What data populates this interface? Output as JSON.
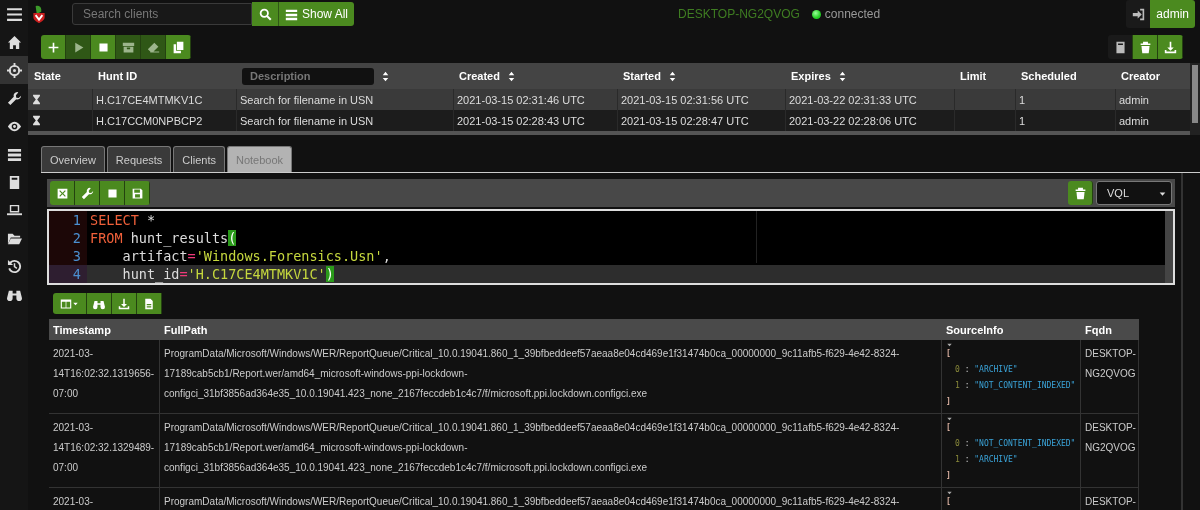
{
  "sidebar": {
    "items": [
      {
        "selected": false
      },
      {
        "selected": true
      },
      {
        "selected": false
      },
      {
        "selected": false
      },
      {
        "selected": false
      },
      {
        "selected": false
      },
      {
        "selected": false
      },
      {
        "selected": false
      },
      {
        "selected": false
      },
      {
        "selected": false
      }
    ]
  },
  "top_bar": {
    "search": {
      "placeholder": "Search clients"
    },
    "show_all": "Show All",
    "hostname": "DESKTOP-NG2QVOG",
    "connected": true,
    "status": "connected",
    "user": "admin"
  },
  "hunt_toolbar": {
    "buttons": [
      {
        "disabled": false
      },
      {
        "disabled": true
      },
      {
        "disabled": false
      },
      {
        "disabled": true
      },
      {
        "disabled": true
      },
      {
        "disabled": false
      }
    ],
    "right_buttons": [
      {
        "disabled": true
      },
      {
        "disabled": false
      },
      {
        "disabled": false
      }
    ]
  },
  "hunts": {
    "columns": [
      {
        "kind": "label",
        "label": "State",
        "sortable": false
      },
      {
        "kind": "label",
        "label": "Hunt ID",
        "sortable": false
      },
      {
        "kind": "filter",
        "placeholder": "Description",
        "sortable": true
      },
      {
        "kind": "label",
        "label": "Created",
        "sortable": true
      },
      {
        "kind": "label",
        "label": "Started",
        "sortable": true
      },
      {
        "kind": "label",
        "label": "Expires",
        "sortable": true
      },
      {
        "kind": "label",
        "label": "Limit",
        "sortable": false
      },
      {
        "kind": "label",
        "label": "Scheduled",
        "sortable": false
      },
      {
        "kind": "label",
        "label": "Creator",
        "sortable": false
      }
    ],
    "rows": [
      {
        "selected": true,
        "hunt_id": "H.C17CE4MTMKV1C",
        "description": "Search for filename in USN",
        "created": "2021-03-15 02:31:46 UTC",
        "started": "2021-03-15 02:31:56 UTC",
        "expires": "2021-03-22 02:31:33 UTC",
        "scheduled": "1",
        "creator": "admin"
      },
      {
        "selected": false,
        "hunt_id": "H.C17CCM0NPBCP2",
        "description": "Search for filename in USN",
        "created": "2021-03-15 02:28:43 UTC",
        "started": "2021-03-15 02:28:47 UTC",
        "expires": "2021-03-22 02:28:06 UTC",
        "scheduled": "1",
        "creator": "admin"
      }
    ]
  },
  "tabs": [
    {
      "label": "Overview",
      "selected": false
    },
    {
      "label": "Requests",
      "selected": false
    },
    {
      "label": "Clients",
      "selected": false
    },
    {
      "label": "Notebook",
      "selected": true
    }
  ],
  "notebook": {
    "language": "VQL",
    "code": [
      {
        "number": "1",
        "active": false,
        "tokens": [
          {
            "kind": "keyword",
            "text": "SELECT"
          },
          {
            "kind": "plain",
            "text": " *"
          }
        ]
      },
      {
        "number": "2",
        "active": false,
        "tokens": [
          {
            "kind": "keyword",
            "text": "FROM"
          },
          {
            "kind": "plain",
            "text": " hunt_results"
          },
          {
            "kind": "bracket-match",
            "text": "("
          }
        ]
      },
      {
        "number": "3",
        "active": false,
        "tokens": [
          {
            "kind": "plain",
            "text": "    artifact"
          },
          {
            "kind": "operator",
            "text": "="
          },
          {
            "kind": "string",
            "text": "'Windows.Forensics.Usn'"
          },
          {
            "kind": "plain",
            "text": ","
          }
        ]
      },
      {
        "number": "4",
        "active": true,
        "tokens": [
          {
            "kind": "plain",
            "text": "    hunt_id"
          },
          {
            "kind": "operator",
            "text": "="
          },
          {
            "kind": "string",
            "text": "'H.C17CE4MTMKV1C'"
          },
          {
            "kind": "bracket-match",
            "text": ")"
          }
        ]
      }
    ]
  },
  "results": {
    "columns": [
      "Timestamp",
      "FullPath",
      "SourceInfo",
      "Fqdn"
    ],
    "rows": [
      {
        "timestamp": [
          "2021-03-",
          "14T16:02:32.1319656-",
          "07:00"
        ],
        "full_path": [
          "ProgramData/Microsoft/Windows/WER/ReportQueue/Critical_10.0.19041.860_1_39bfbeddeef57aeaa8e04cd469e1f31474b0ca_00000000_9c11afb5-f629-4e42-8324-",
          "17189cab5cb1/Report.wer/amd64_microsoft-windows-ppi-lockdown-",
          "configci_31bf3856ad364e35_10.0.19041.423_none_2167feccdeb1c4c7/f/microsoft.ppi.lockdown.configci.exe"
        ],
        "source_info": {
          "open": "[",
          "items": [
            {
              "index": "0",
              "separator": ":",
              "value": "\"ARCHIVE\""
            },
            {
              "index": "1",
              "separator": ":",
              "value": "\"NOT_CONTENT_INDEXED\""
            }
          ],
          "close": "]"
        },
        "fqdn": [
          "DESKTOP-",
          "NG2QVOG"
        ]
      },
      {
        "timestamp": [
          "2021-03-",
          "14T16:02:32.1329489-",
          "07:00"
        ],
        "full_path": [
          "ProgramData/Microsoft/Windows/WER/ReportQueue/Critical_10.0.19041.860_1_39bfbeddeef57aeaa8e04cd469e1f31474b0ca_00000000_9c11afb5-f629-4e42-8324-",
          "17189cab5cb1/Report.wer/amd64_microsoft-windows-ppi-lockdown-",
          "configci_31bf3856ad364e35_10.0.19041.423_none_2167feccdeb1c4c7/f/microsoft.ppi.lockdown.configci.exe"
        ],
        "source_info": {
          "open": "[",
          "items": [
            {
              "index": "0",
              "separator": ":",
              "value": "\"NOT_CONTENT_INDEXED\""
            },
            {
              "index": "1",
              "separator": ":",
              "value": "\"ARCHIVE\""
            }
          ],
          "close": "]"
        },
        "fqdn": [
          "DESKTOP-",
          "NG2QVOG"
        ]
      },
      {
        "timestamp": [
          "2021-03-"
        ],
        "full_path": [
          "ProgramData/Microsoft/Windows/WER/ReportQueue/Critical_10.0.19041.860_1_39bfbeddeef57aeaa8e04cd469e1f31474b0ca_00000000_9c11afb5-f629-4e42-8324-"
        ],
        "source_info": {
          "open": "["
        },
        "fqdn": [
          "DESKTOP-"
        ]
      }
    ]
  }
}
